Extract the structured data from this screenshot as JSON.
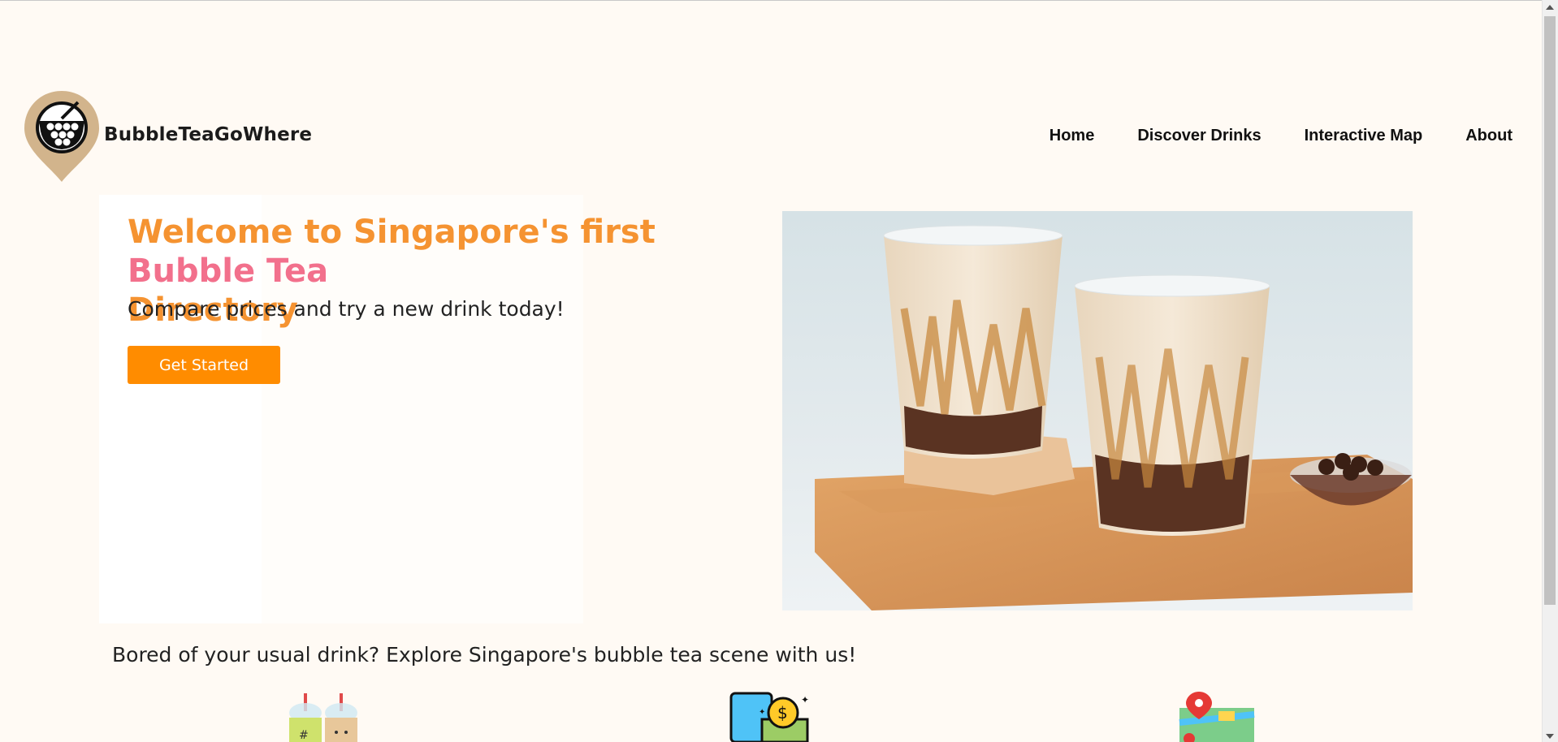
{
  "header": {
    "brand": "BubbleTeaGoWhere",
    "logo_icon": "bubble-tea-map-pin-icon",
    "nav": [
      "Home",
      "Discover Drinks",
      "Interactive Map",
      "About"
    ]
  },
  "hero": {
    "title_part1": "Welcome to Singapore's first ",
    "title_part2": "Bubble Tea",
    "title_part3": "Directory",
    "subtitle": "Compare prices and try a new drink today!",
    "cta_label": "Get Started",
    "image_name": "bubble-tea-cups-photo"
  },
  "tagline": "Bored of your usual drink? Explore Singapore's bubble tea scene with us!",
  "features": {
    "icons": [
      "drinks-icon",
      "price-compare-icon",
      "map-icon"
    ]
  },
  "colors": {
    "accent_orange": "#ff8c00",
    "title_orange": "#f59331",
    "title_pink": "#f2708c",
    "background": "#fffaf4"
  }
}
